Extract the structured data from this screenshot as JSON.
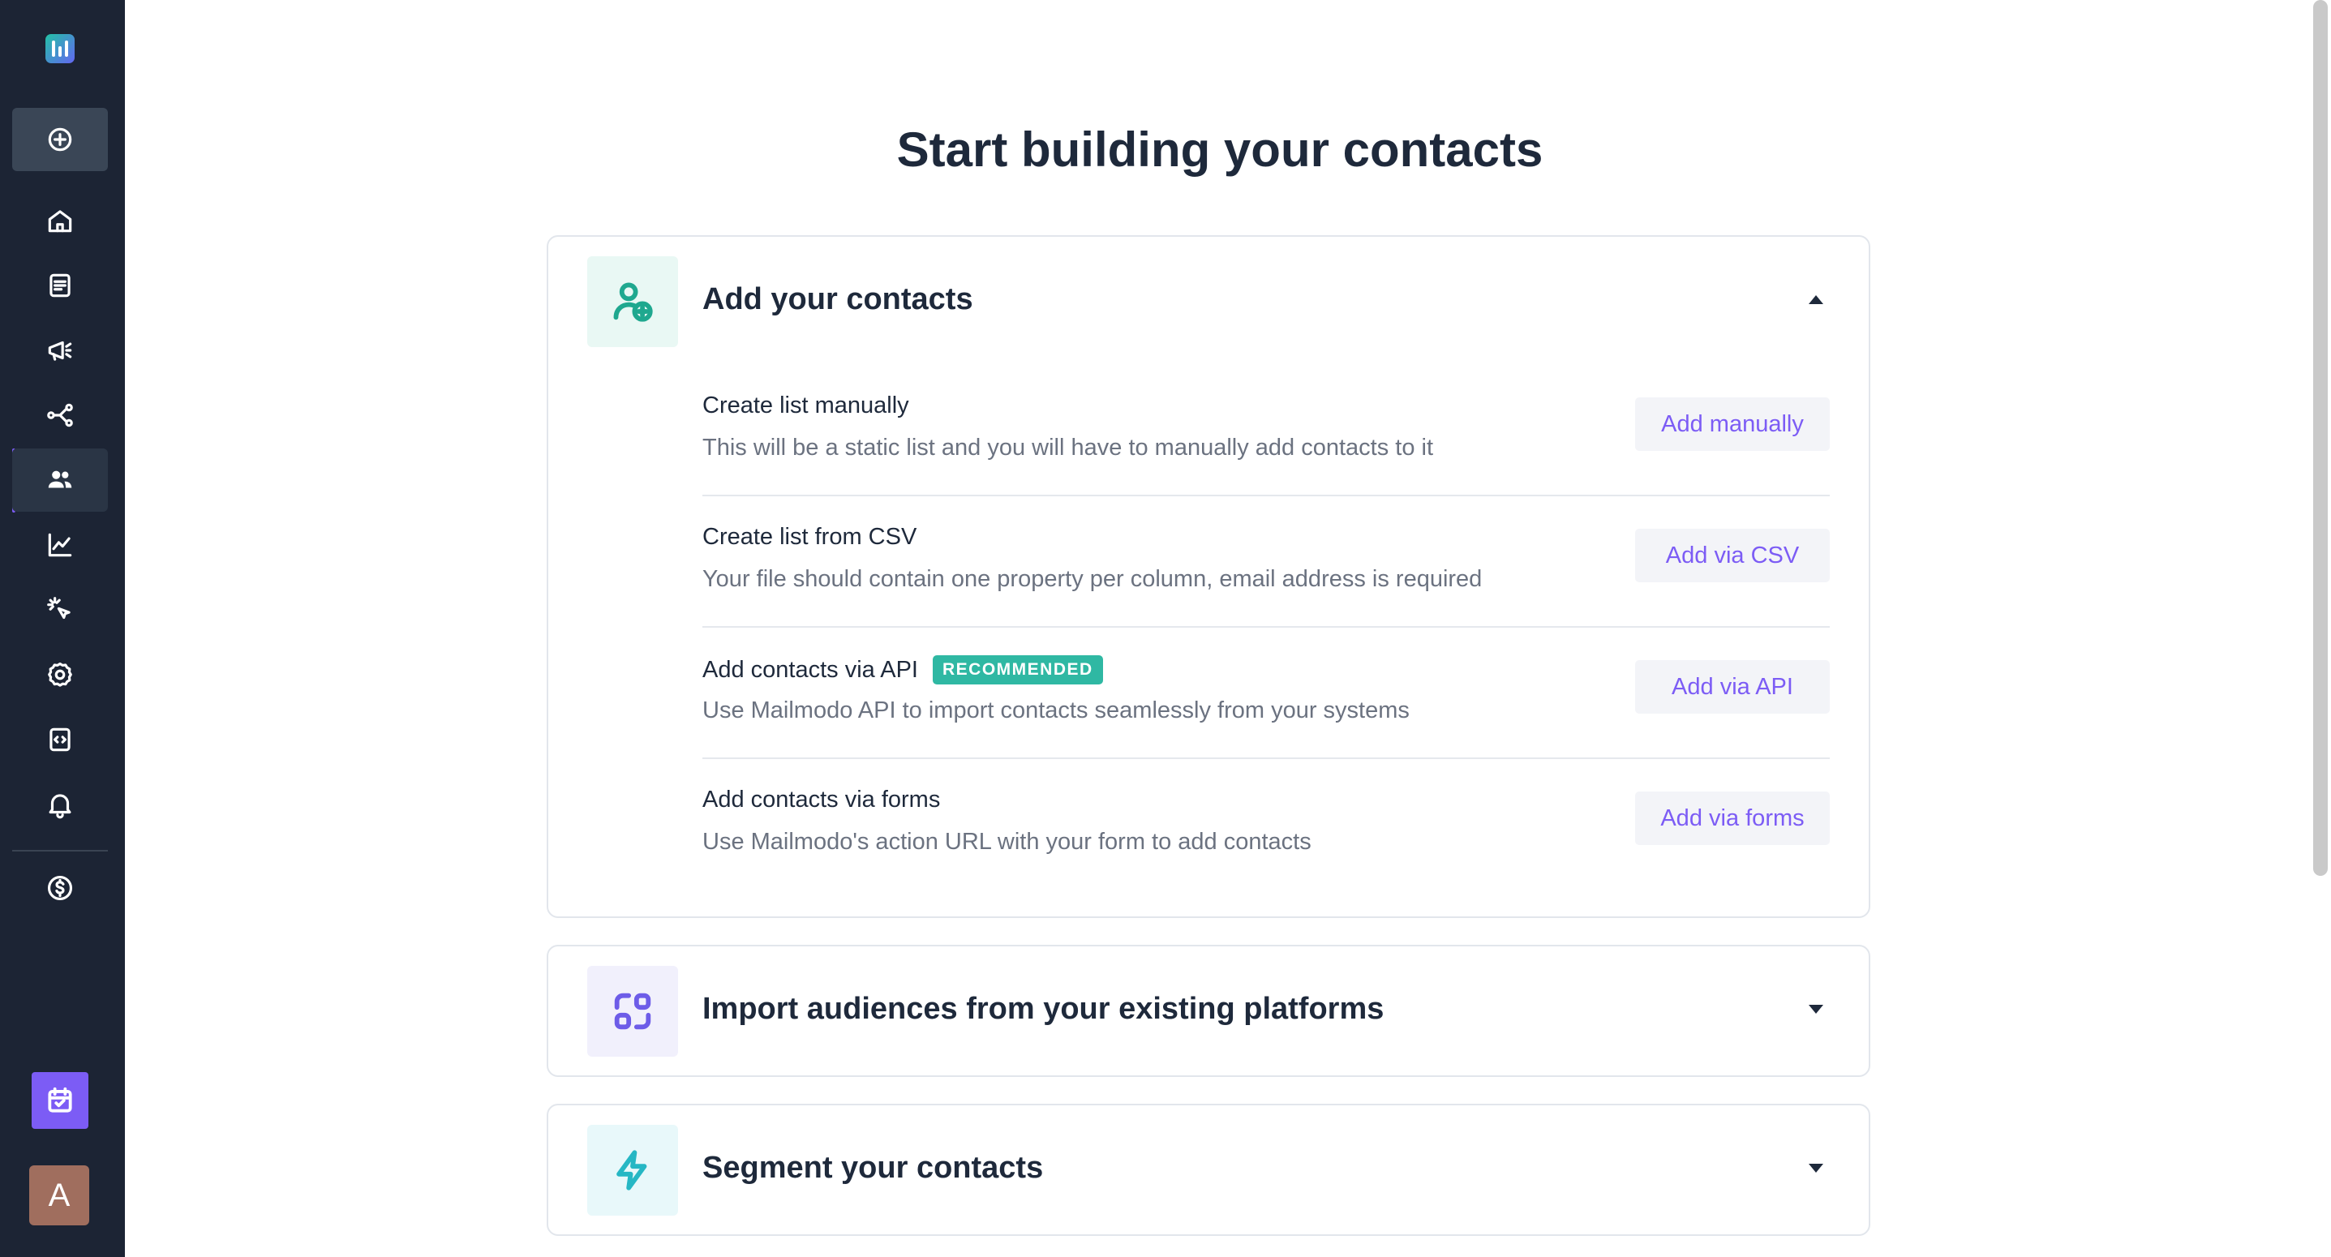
{
  "sidebar": {
    "items": [
      {
        "name": "create",
        "icon": "plus-circle-icon"
      },
      {
        "name": "home",
        "icon": "home-icon"
      },
      {
        "name": "templates",
        "icon": "document-icon"
      },
      {
        "name": "campaigns",
        "icon": "megaphone-icon"
      },
      {
        "name": "journeys",
        "icon": "flow-icon"
      },
      {
        "name": "contacts",
        "icon": "users-icon",
        "active": true
      },
      {
        "name": "analytics",
        "icon": "chart-icon"
      },
      {
        "name": "interactions",
        "icon": "cursor-click-icon"
      },
      {
        "name": "settings",
        "icon": "gear-icon"
      },
      {
        "name": "developer",
        "icon": "code-icon"
      },
      {
        "name": "notifications",
        "icon": "bell-icon"
      },
      {
        "name": "billing",
        "icon": "dollar-icon"
      }
    ],
    "avatar_initial": "A"
  },
  "page": {
    "title": "Start building your contacts"
  },
  "sections": [
    {
      "title": "Add your contacts",
      "expanded": true,
      "icon": "user-plus-icon",
      "rows": [
        {
          "title": "Create list manually",
          "desc": "This will be a static list and you will have to manually add contacts to it",
          "button": "Add manually"
        },
        {
          "title": "Create list from CSV",
          "desc": "Your file should contain one property per column, email address is required",
          "button": "Add via CSV"
        },
        {
          "title": "Add contacts via API",
          "badge": "RECOMMENDED",
          "desc": "Use Mailmodo API to import contacts seamlessly from your systems",
          "button": "Add via API"
        },
        {
          "title": "Add contacts via forms",
          "desc": "Use Mailmodo's action URL with your form to add contacts",
          "button": "Add via forms"
        }
      ]
    },
    {
      "title": "Import audiences from your existing platforms",
      "expanded": false,
      "icon": "apps-icon"
    },
    {
      "title": "Segment your contacts",
      "expanded": false,
      "icon": "lightning-icon"
    }
  ],
  "colors": {
    "sidebar_bg": "#1c2434",
    "accent": "#7c5cf5",
    "badge": "#2fb8a3",
    "green_icon": "#1fa88f",
    "purple_icon": "#6d5ce8",
    "teal_icon": "#26b7c4"
  }
}
